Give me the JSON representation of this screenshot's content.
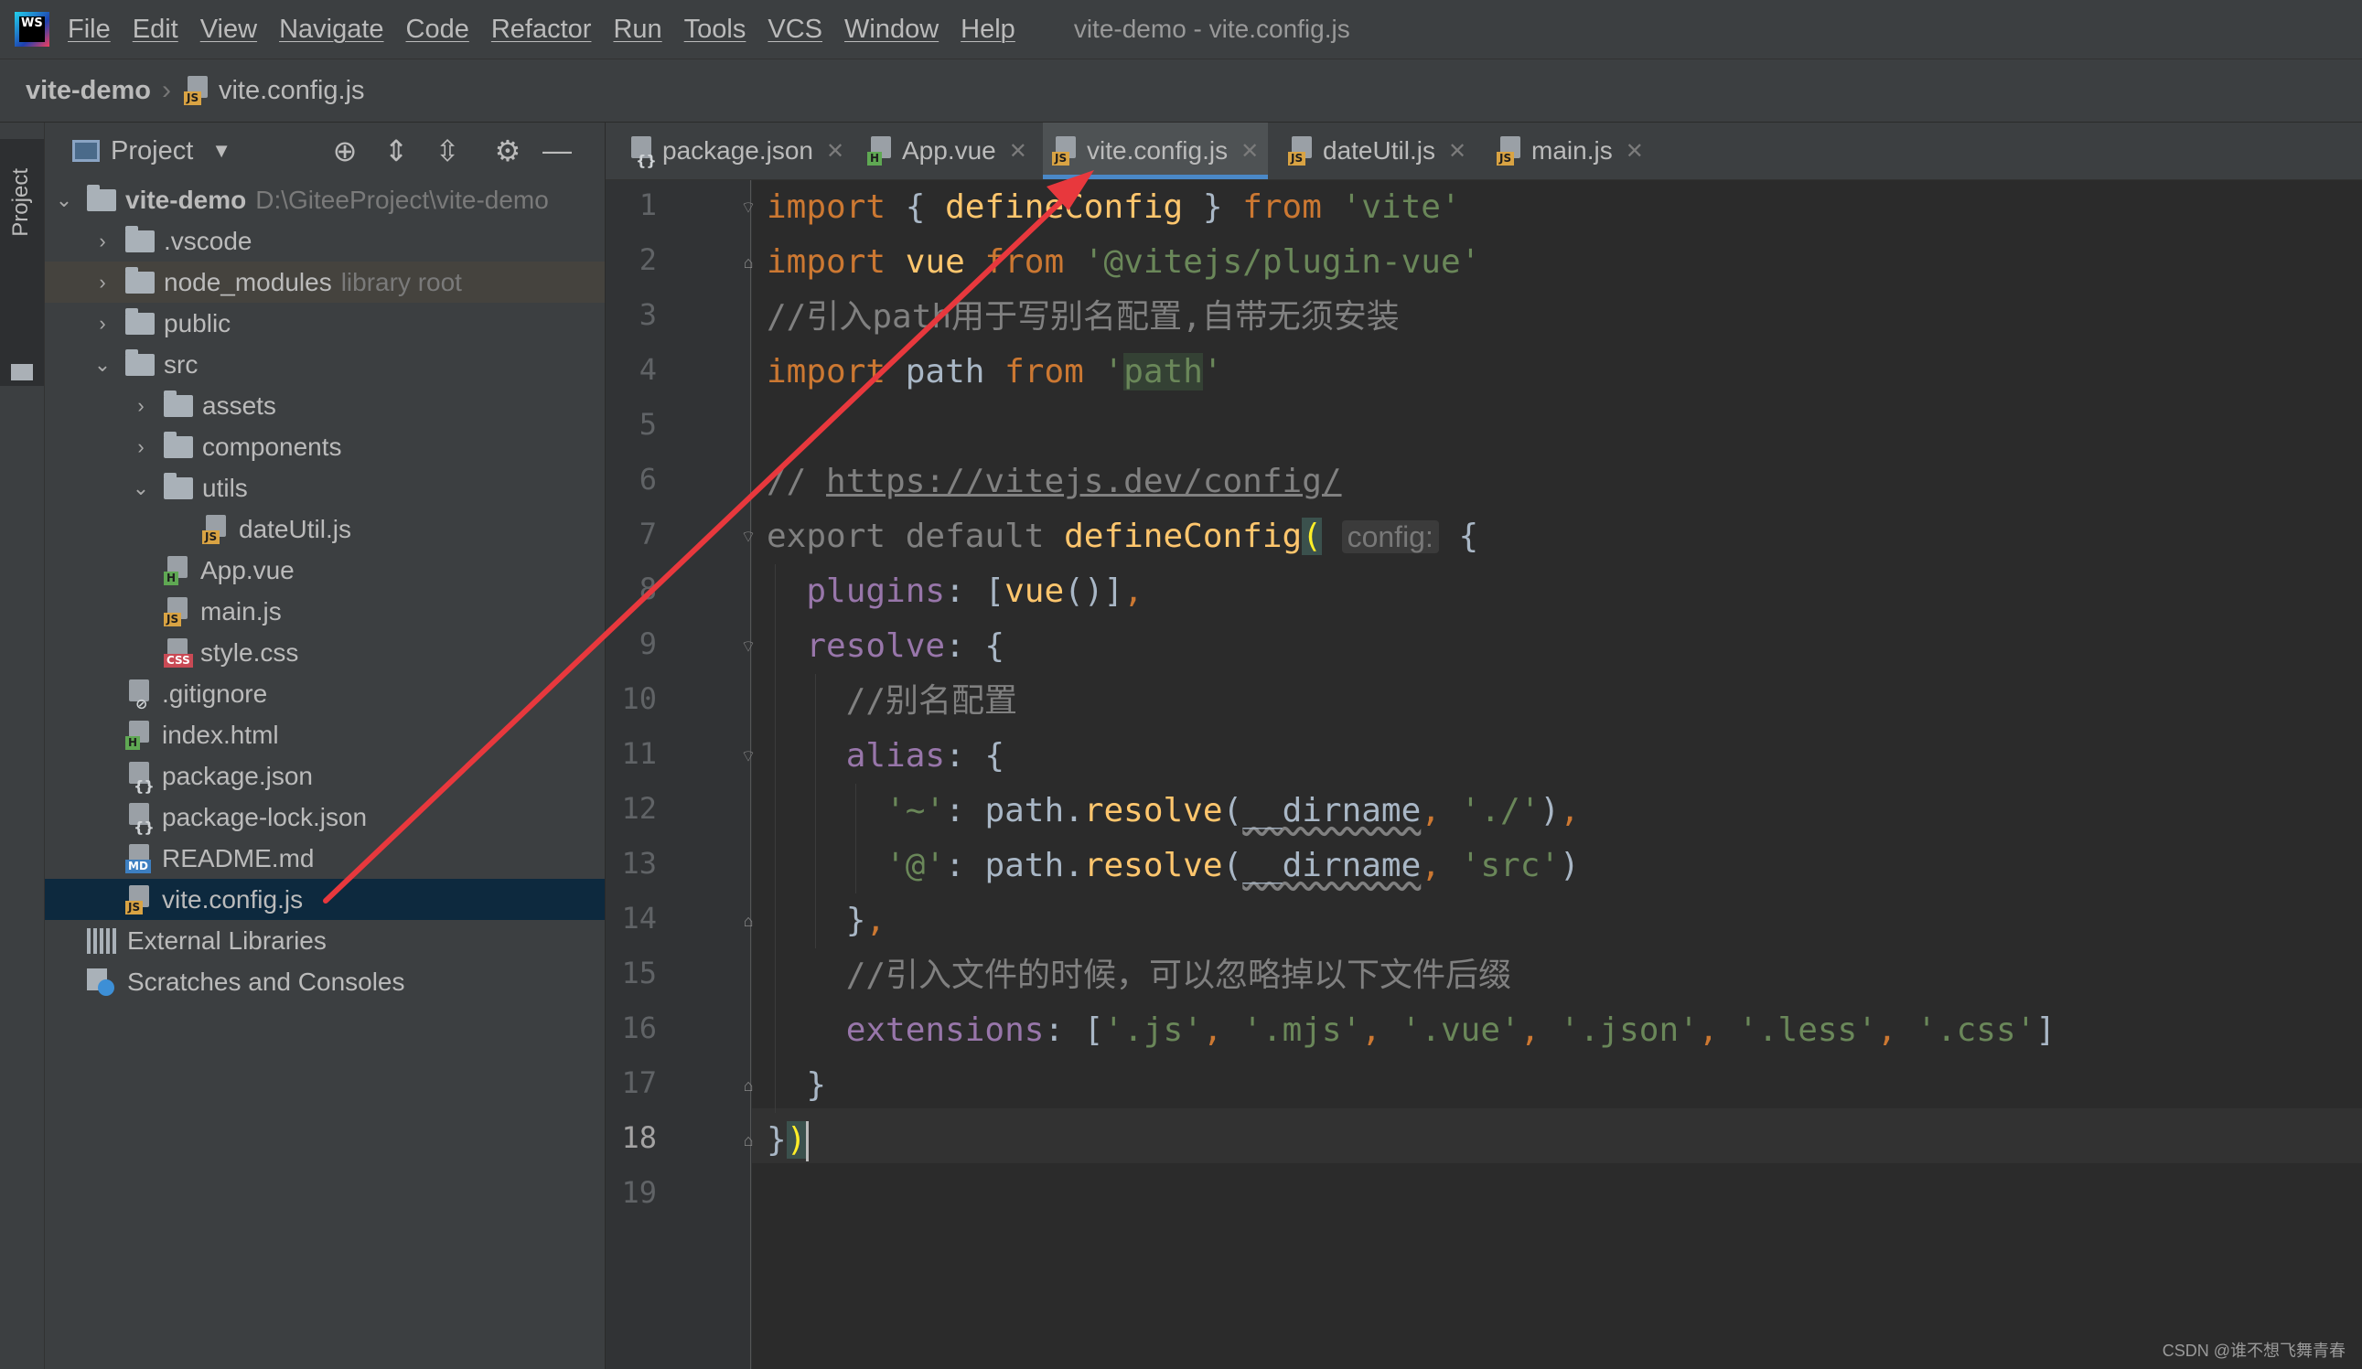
{
  "menubar": {
    "logo": "WS",
    "items": [
      "File",
      "Edit",
      "View",
      "Navigate",
      "Code",
      "Refactor",
      "Run",
      "Tools",
      "VCS",
      "Window",
      "Help"
    ],
    "window_title": "vite-demo - vite.config.js"
  },
  "navbar": {
    "root": "vite-demo",
    "file": "vite.config.js"
  },
  "toolstrip": {
    "project_label": "Project"
  },
  "project_panel": {
    "title": "Project",
    "root": {
      "name": "vite-demo",
      "path": "D:\\GiteeProject\\vite-demo"
    },
    "node_modules_hint": "library root",
    "items": [
      ".vscode",
      "node_modules",
      "public",
      "src",
      "assets",
      "components",
      "utils",
      "dateUtil.js",
      "App.vue",
      "main.js",
      "style.css",
      ".gitignore",
      "index.html",
      "package.json",
      "package-lock.json",
      "README.md",
      "vite.config.js",
      "External Libraries",
      "Scratches and Consoles"
    ]
  },
  "tabs": [
    {
      "label": "package.json",
      "icon": "json-file-icon"
    },
    {
      "label": "App.vue",
      "icon": "vue-file-icon"
    },
    {
      "label": "vite.config.js",
      "icon": "js-file-icon",
      "active": true
    },
    {
      "label": "dateUtil.js",
      "icon": "js-file-icon"
    },
    {
      "label": "main.js",
      "icon": "js-file-icon"
    }
  ],
  "editor": {
    "line_numbers": [
      "1",
      "2",
      "3",
      "4",
      "5",
      "6",
      "7",
      "8",
      "9",
      "10",
      "11",
      "12",
      "13",
      "14",
      "15",
      "16",
      "17",
      "18",
      "19"
    ],
    "current_line": 18,
    "tokens": {
      "import": "import",
      "define_config": "defineConfig",
      "from": "from",
      "vite_str": "'vite'",
      "vue": "vue",
      "plugin_vue_str": "'@vitejs/plugin-vue'",
      "comment_path": "//引入path用于写别名配置,自带无须安装",
      "path": "path",
      "path_str_open": "'",
      "path_str_word": "path",
      "path_str_close": "'",
      "comment_slashes": "// ",
      "config_url": "https://vitejs.dev/config/",
      "export_default": "export default ",
      "config_hint": "config:",
      "plugins": "plugins",
      "resolve": "resolve",
      "comment_alias": "//别名配置",
      "alias": "alias",
      "tilde_key": "'~'",
      "at_key": "'@'",
      "path_resolve": "path.",
      "resolve_fn": "resolve",
      "dirname": "__dirname",
      "dot_slash": "'./'",
      "src": "'src'",
      "comment_ext": "//引入文件的时候，可以忽略掉以下文件后缀",
      "extensions": "extensions",
      "ext_js": "'.js'",
      "ext_mjs": "'.mjs'",
      "ext_vue": "'.vue'",
      "ext_json": "'.json'",
      "ext_less": "'.less'",
      "ext_css": "'.css'"
    }
  },
  "watermark": "CSDN @谁不想飞舞青春",
  "colors": {
    "annotation_arrow": "#e8383d",
    "active_tab_underline": "#4a88c7",
    "selection": "#0d293e"
  }
}
